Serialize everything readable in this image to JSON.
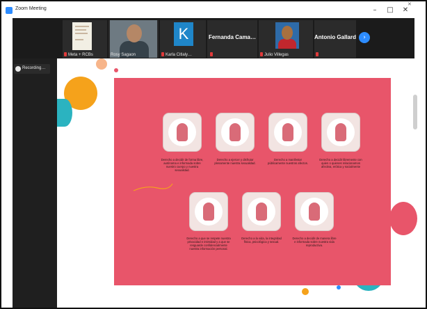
{
  "window": {
    "title": "Zoom Meeting",
    "minimize": "–",
    "maximize": "□",
    "close": "✕",
    "overflow_close": "✕"
  },
  "participants": [
    {
      "name": "Meta + RCBs",
      "type": "screen-thumbnail"
    },
    {
      "name": "Rosy Sagaon",
      "type": "video"
    },
    {
      "name": "Karla Citlaly…",
      "type": "avatar",
      "initial": "K"
    },
    {
      "name": "Fernanda Cama…",
      "type": "name-only"
    },
    {
      "name": "Julio Villegas",
      "type": "photo"
    },
    {
      "name": "Antonio Gallardo",
      "type": "name-only"
    }
  ],
  "next_page_icon": "chevron-right-icon",
  "recording": {
    "label": "Recording…"
  },
  "slide": {
    "background_color": "#e8556a",
    "cards": [
      {
        "caption": "Derecho a decidir de forma libre, autónoma e informada sobre nuestro cuerpo y nuestra sexualidad."
      },
      {
        "caption": "Derecho a ejercer y disfrutar plenamente nuestra sexualidad."
      },
      {
        "caption": "Derecho a manifestar públicamente nuestros afectos."
      },
      {
        "caption": "Derecho a decidir libremente con quien o quienes relacionarnos afectiva, erótica y socialmente"
      },
      {
        "caption": "Derecho a que se respete nuestra privacidad e intimidad y a que se resguarde confidencialmente nuestra información personal."
      },
      {
        "caption": "Derecho a la vida, la integridad física, psicológica y sexual."
      },
      {
        "caption": "Derecho a decidir de manera libre e informada sobre nuestra vida reproductiva."
      }
    ]
  },
  "colors": {
    "accent": "#2d8cff",
    "meeting_bg": "#1f1f1f",
    "mic_muted": "#e03a3a"
  }
}
